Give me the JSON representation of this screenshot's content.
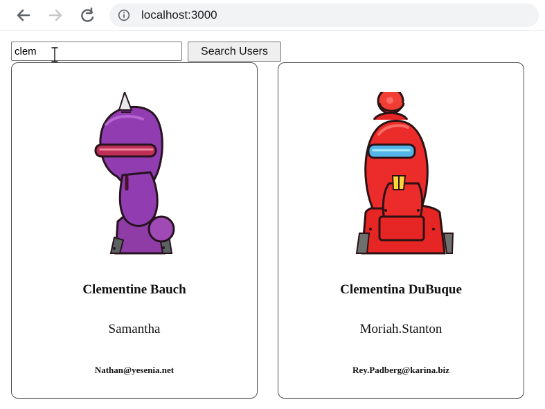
{
  "browser": {
    "url_text": "localhost:3000",
    "icons": [
      "back-icon",
      "forward-icon",
      "reload-icon",
      "info-icon"
    ]
  },
  "search": {
    "value": "clem",
    "button_label": "Search Users"
  },
  "users": [
    {
      "name": "Clementine Bauch",
      "username": "Samantha",
      "email": "Nathan@yesenia.net",
      "avatar_icon": "purple-robot-avatar-icon",
      "avatar_color": "#8f3ca6"
    },
    {
      "name": "Clementina DuBuque",
      "username": "Moriah.Stanton",
      "email": "Rey.Padberg@karina.biz",
      "avatar_icon": "red-robot-avatar-icon",
      "avatar_color": "#e62625"
    }
  ],
  "colors": {
    "card_border": "#4d4d4d",
    "address_bar": "#f1f3f4",
    "button_background": "#efefef"
  }
}
